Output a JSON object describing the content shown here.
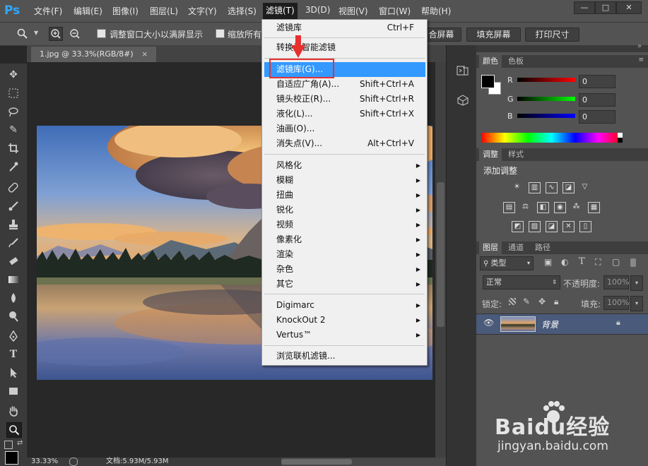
{
  "app": {
    "logo": "Ps"
  },
  "menubar": {
    "items": [
      "文件(F)",
      "编辑(E)",
      "图像(I)",
      "图层(L)",
      "文字(Y)",
      "选择(S)",
      "滤镜(T)",
      "3D(D)",
      "视图(V)",
      "窗口(W)",
      "帮助(H)"
    ],
    "active_index": 6,
    "window_buttons": [
      "—",
      "□",
      "✕"
    ]
  },
  "options": {
    "check1": "调整窗口大小以满屏显示",
    "check2": "缩放所有",
    "btn_fit": "合屏幕",
    "btn_fill": "填充屏幕",
    "btn_print": "打印尺寸"
  },
  "document": {
    "tab_title": "1.jpg @ 33.3%(RGB/8#)",
    "tab_close": "×"
  },
  "statusbar": {
    "zoom": "33.33%",
    "doc": "文档:5.93M/5.93M"
  },
  "filter_menu": {
    "items": [
      {
        "label": "滤镜库",
        "shortcut": "Ctrl+F"
      },
      {
        "label": "转换为智能滤镜"
      },
      {
        "label": "滤镜库(G)...",
        "highlighted": true
      },
      {
        "label": "自适应广角(A)...",
        "shortcut": "Shift+Ctrl+A"
      },
      {
        "label": "镜头校正(R)...",
        "shortcut": "Shift+Ctrl+R"
      },
      {
        "label": "液化(L)...",
        "shortcut": "Shift+Ctrl+X"
      },
      {
        "label": "油画(O)..."
      },
      {
        "label": "消失点(V)...",
        "shortcut": "Alt+Ctrl+V"
      },
      {
        "label": "风格化",
        "submenu": true
      },
      {
        "label": "模糊",
        "submenu": true
      },
      {
        "label": "扭曲",
        "submenu": true
      },
      {
        "label": "锐化",
        "submenu": true
      },
      {
        "label": "视频",
        "submenu": true
      },
      {
        "label": "像素化",
        "submenu": true
      },
      {
        "label": "渲染",
        "submenu": true
      },
      {
        "label": "杂色",
        "submenu": true
      },
      {
        "label": "其它",
        "submenu": true
      },
      {
        "label": "Digimarc",
        "submenu": true
      },
      {
        "label": "KnockOut 2",
        "submenu": true
      },
      {
        "label": "Vertus™",
        "submenu": true
      },
      {
        "label": "浏览联机滤镜..."
      }
    ]
  },
  "color_panel": {
    "tabs": [
      "颜色",
      "色板"
    ],
    "channels": [
      {
        "name": "R",
        "value": "0"
      },
      {
        "name": "G",
        "value": "0"
      },
      {
        "name": "B",
        "value": "0"
      }
    ]
  },
  "adjust_panel": {
    "tabs": [
      "调整",
      "样式"
    ],
    "title": "添加调整"
  },
  "layers_panel": {
    "tabs": [
      "图层",
      "通道",
      "路径"
    ],
    "filter_kind": "类型",
    "blend_mode": "正常",
    "opacity_label": "不透明度:",
    "opacity_value": "100%",
    "lock_label": "锁定:",
    "fill_label": "填充:",
    "fill_value": "100%",
    "layer_name": "背景"
  },
  "watermark": {
    "brand": "Baidu经验",
    "url": "jingyan.baidu.com"
  },
  "colors": {
    "highlight": "#3399ff",
    "annotation": "#e8302f",
    "ps_blue": "#31a8ff"
  }
}
